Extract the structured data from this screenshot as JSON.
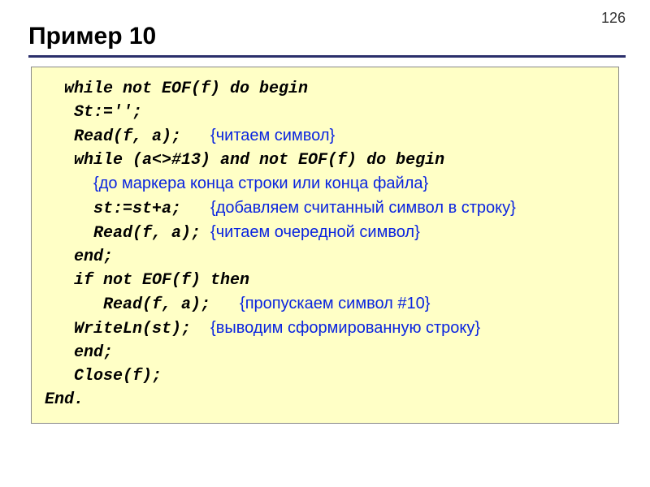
{
  "page_number": "126",
  "title": "Пример 10",
  "code": {
    "l1": "  while not EOF(f) do begin",
    "l2": "   St:='';",
    "l3a": "   Read(f, a);   ",
    "l3c": "{читаем символ}",
    "l4": "   while (a<>#13) and not EOF(f) do begin",
    "l5i": "     ",
    "l5c": "{до маркера конца строки или конца файла}",
    "l6a": "     st:=st+a;   ",
    "l6c": "{добавляем считанный символ в строку}",
    "l7a": "     Read(f, a); ",
    "l7c": "{читаем очередной символ}",
    "l8": "   end;",
    "l9": "   if not EOF(f) then",
    "l10a": "      Read(f, a);   ",
    "l10c": "{пропускаем символ #10}",
    "l11a": "   WriteLn(st);  ",
    "l11c": "{выводим сформированную строку}",
    "l12": "   end;",
    "l13": "   Close(f);",
    "l14": "End."
  }
}
